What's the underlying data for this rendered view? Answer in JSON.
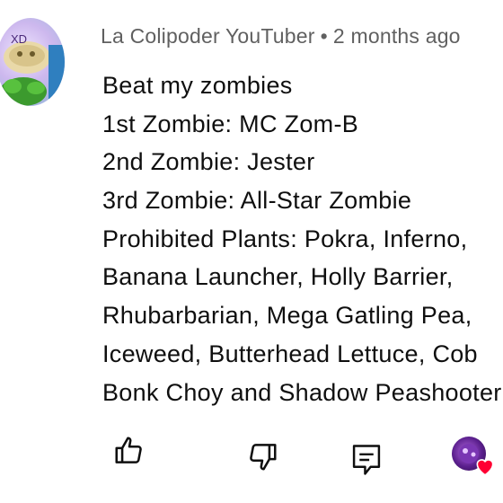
{
  "comment": {
    "author": "La Colipoder YouTuber",
    "separator": "•",
    "timestamp": "2 months ago",
    "avatar_badge": "XD",
    "lines": [
      "Beat my zombies",
      "1st Zombie: MC Zom-B",
      "2nd Zombie: Jester",
      "3rd Zombie: All-Star Zombie",
      "Prohibited Plants: Pokra, Inferno,",
      "Banana Launcher, Holly Barrier,",
      "Rhubarbarian, Mega Gatling Pea,",
      "Iceweed, Butterhead Lettuce, Cob",
      "Bonk Choy and Shadow Peashooter"
    ]
  },
  "actions": {
    "like_icon": "thumbs-up-icon",
    "dislike_icon": "thumbs-down-icon",
    "reply_icon": "reply-comment-icon",
    "creator_heart_icon": "creator-heart-icon"
  },
  "colors": {
    "meta_text": "#606060",
    "body_text": "#0f0f0f",
    "heart": "#ff0033"
  }
}
